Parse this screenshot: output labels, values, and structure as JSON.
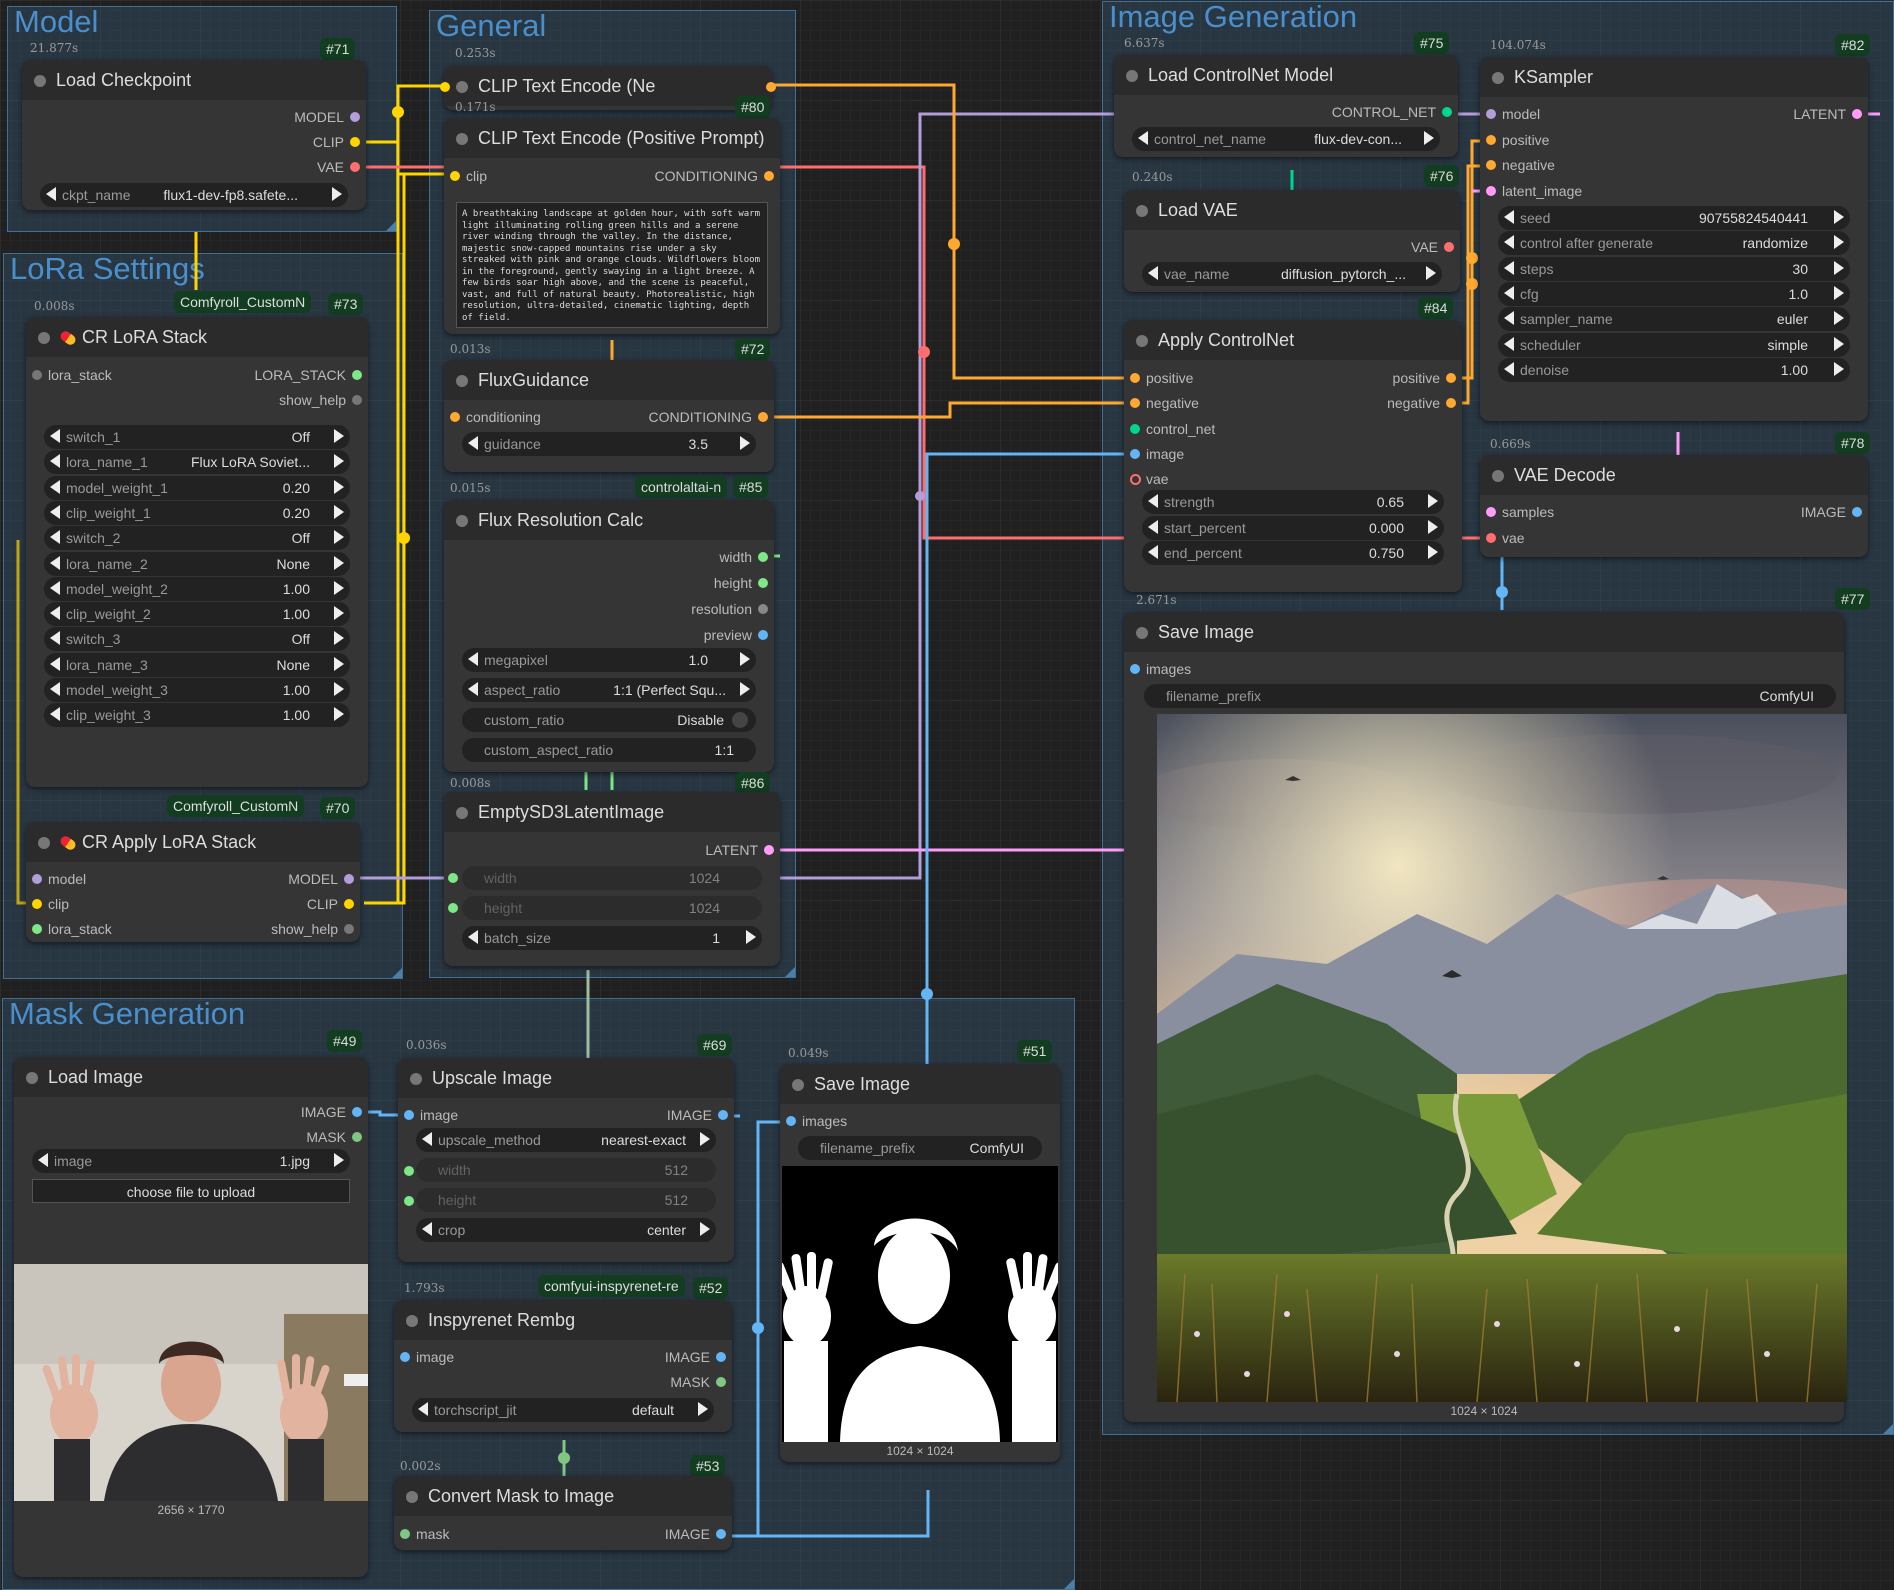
{
  "groups": {
    "model": "Model",
    "general": "General",
    "lora": "LoRa Settings",
    "image_gen": "Image Generation",
    "mask_gen": "Mask Generation"
  },
  "colors": {
    "model": "#b39ddb",
    "clip": "#ffd500",
    "vae": "#ff6e6e",
    "conditioning": "#ffa931",
    "latent": "#ff9cf9",
    "image": "#64b5f6",
    "mask": "#81c784",
    "control_net": "#00d78d",
    "int": "#7ee787"
  },
  "nodes": {
    "load_checkpoint": {
      "id": "#71",
      "time": "21.877s",
      "title": "Load Checkpoint",
      "outputs": [
        "MODEL",
        "CLIP",
        "VAE"
      ],
      "ckpt_label": "ckpt_name",
      "ckpt_value": "flux1-dev-fp8.safete..."
    },
    "clip_neg": {
      "time": "0.253s",
      "title": "CLIP Text Encode (Ne"
    },
    "clip_pos": {
      "id": "#80",
      "time": "0.171s",
      "title": "CLIP Text Encode (Positive Prompt)",
      "input": "clip",
      "output": "CONDITIONING",
      "prompt": "A breathtaking landscape at golden hour, with soft warm light illuminating rolling green hills and a serene river winding through the valley. In the distance, majestic snow-capped mountains rise under a sky streaked with pink and orange clouds. Wildflowers bloom in the foreground, gently swaying in a light breeze. A few birds soar high above, and the scene is peaceful, vast, and full of natural beauty. Photorealistic, high resolution, ultra-detailed, cinematic lighting, depth of field."
    },
    "flux_guidance": {
      "id": "#72",
      "time": "0.013s",
      "title": "FluxGuidance",
      "input": "conditioning",
      "output": "CONDITIONING",
      "guidance_label": "guidance",
      "guidance_value": "3.5"
    },
    "flux_res": {
      "id": "#85",
      "badge": "controlaltai-n",
      "time": "0.015s",
      "title": "Flux Resolution Calc",
      "outputs": [
        "width",
        "height",
        "resolution",
        "preview"
      ],
      "megapixel_label": "megapixel",
      "megapixel_value": "1.0",
      "aspect_label": "aspect_ratio",
      "aspect_value": "1:1 (Perfect Squ...",
      "custom_ratio_label": "custom_ratio",
      "custom_ratio_value": "Disable",
      "custom_aspect_label": "custom_aspect_ratio",
      "custom_aspect_value": "1:1"
    },
    "empty_latent": {
      "id": "#86",
      "time": "0.008s",
      "title": "EmptySD3LatentImage",
      "output": "LATENT",
      "width_label": "width",
      "width_value": "1024",
      "height_label": "height",
      "height_value": "1024",
      "batch_label": "batch_size",
      "batch_value": "1"
    },
    "cr_lora_stack": {
      "id": "#73",
      "badge": "Comfyroll_CustomN",
      "time": "0.008s",
      "title": "CR LoRA Stack",
      "input": "lora_stack",
      "outputs": [
        "LORA_STACK",
        "show_help"
      ],
      "widgets": [
        {
          "label": "switch_1",
          "value": "Off"
        },
        {
          "label": "lora_name_1",
          "value": "Flux LoRA Soviet..."
        },
        {
          "label": "model_weight_1",
          "value": "0.20"
        },
        {
          "label": "clip_weight_1",
          "value": "0.20"
        },
        {
          "label": "switch_2",
          "value": "Off"
        },
        {
          "label": "lora_name_2",
          "value": "None"
        },
        {
          "label": "model_weight_2",
          "value": "1.00"
        },
        {
          "label": "clip_weight_2",
          "value": "1.00"
        },
        {
          "label": "switch_3",
          "value": "Off"
        },
        {
          "label": "lora_name_3",
          "value": "None"
        },
        {
          "label": "model_weight_3",
          "value": "1.00"
        },
        {
          "label": "clip_weight_3",
          "value": "1.00"
        }
      ]
    },
    "cr_apply_lora": {
      "id": "#70",
      "badge": "Comfyroll_CustomN",
      "title": "CR Apply LoRA Stack",
      "inputs": [
        "model",
        "clip",
        "lora_stack"
      ],
      "outputs": [
        "MODEL",
        "CLIP",
        "show_help"
      ]
    },
    "load_controlnet": {
      "id": "#75",
      "time": "6.637s",
      "title": "Load ControlNet Model",
      "output": "CONTROL_NET",
      "cn_label": "control_net_name",
      "cn_value": "flux-dev-con..."
    },
    "load_vae": {
      "id": "#76",
      "time": "0.240s",
      "title": "Load VAE",
      "output": "VAE",
      "vae_label": "vae_name",
      "vae_value": "diffusion_pytorch_..."
    },
    "apply_controlnet": {
      "id": "#84",
      "title": "Apply ControlNet",
      "inputs": [
        "positive",
        "negative",
        "control_net",
        "image",
        "vae"
      ],
      "outputs": [
        "positive",
        "negative"
      ],
      "widgets": [
        {
          "label": "strength",
          "value": "0.65"
        },
        {
          "label": "start_percent",
          "value": "0.000"
        },
        {
          "label": "end_percent",
          "value": "0.750"
        }
      ]
    },
    "ksampler": {
      "id": "#82",
      "time": "104.074s",
      "title": "KSampler",
      "inputs": [
        "model",
        "positive",
        "negative",
        "latent_image"
      ],
      "output": "LATENT",
      "widgets": [
        {
          "label": "seed",
          "value": "90755824540441"
        },
        {
          "label": "control after generate",
          "value": "randomize"
        },
        {
          "label": "steps",
          "value": "30"
        },
        {
          "label": "cfg",
          "value": "1.0"
        },
        {
          "label": "sampler_name",
          "value": "euler"
        },
        {
          "label": "scheduler",
          "value": "simple"
        },
        {
          "label": "denoise",
          "value": "1.00"
        }
      ]
    },
    "vae_decode": {
      "id": "#78",
      "time": "0.669s",
      "title": "VAE Decode",
      "inputs": [
        "samples",
        "vae"
      ],
      "output": "IMAGE"
    },
    "save_image_main": {
      "id": "#77",
      "time": "2.671s",
      "title": "Save Image",
      "input": "images",
      "prefix_label": "filename_prefix",
      "prefix_value": "ComfyUI",
      "caption": "1024 × 1024"
    },
    "load_image": {
      "id": "#49",
      "title": "Load Image",
      "outputs": [
        "IMAGE",
        "MASK"
      ],
      "image_label": "image",
      "image_value": "1.jpg",
      "upload": "choose file to upload",
      "caption": "2656 × 1770"
    },
    "upscale": {
      "id": "#69",
      "time": "0.036s",
      "title": "Upscale Image",
      "input": "image",
      "output": "IMAGE",
      "method_label": "upscale_method",
      "method_value": "nearest-exact",
      "width_label": "width",
      "width_value": "512",
      "height_label": "height",
      "height_value": "512",
      "crop_label": "crop",
      "crop_value": "center"
    },
    "save_image_mask": {
      "id": "#51",
      "time": "0.049s",
      "title": "Save Image",
      "input": "images",
      "prefix_label": "filename_prefix",
      "prefix_value": "ComfyUI",
      "caption": "1024 × 1024"
    },
    "inspyrenet": {
      "id": "#52",
      "badge": "comfyui-inspyrenet-re",
      "time": "1.793s",
      "title": "Inspyrenet Rembg",
      "input": "image",
      "outputs": [
        "IMAGE",
        "MASK"
      ],
      "jit_label": "torchscript_jit",
      "jit_value": "default"
    },
    "mask_to_image": {
      "id": "#53",
      "time": "0.002s",
      "title": "Convert Mask to Image",
      "input": "mask",
      "output": "IMAGE"
    }
  }
}
